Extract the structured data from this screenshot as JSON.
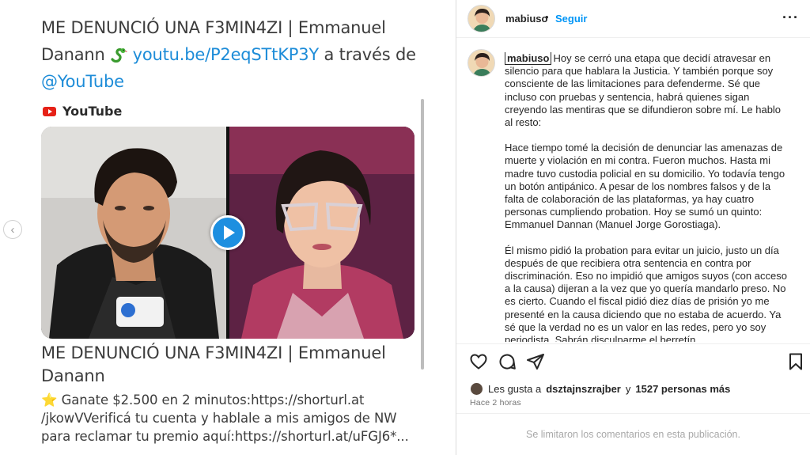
{
  "tweet": {
    "text_before_link": "ME DENUNCIÓ UNA F3MIN4ZI | Emmanuel Danann",
    "link": "youtu.be/P2eqSTtKP3Y",
    "text_after_link": "a través de",
    "mention": "@YouTube",
    "card_source": "YouTube",
    "card_title": "ME DENUNCIÓ UNA F3MIN4ZI | Emmanuel Danann",
    "card_description_star": "⭐",
    "card_description": "Ganate $2.500 en 2 minutos:https://shorturl.at /jkowVVerificá tu cuenta y hablale a mis amigos de NW para reclamar tu premio aquí:https://shorturl.at/uFGJ6*..."
  },
  "post": {
    "username": "mabiuso",
    "follow_label": "Seguir",
    "more_label": "···",
    "caption_user": "mabiuso",
    "caption_paragraphs": [
      "Hoy se cerró una etapa que decidí atravesar en silencio para que hablara la Justicia. Y también porque soy consciente de las limitaciones para defenderme. Sé que incluso con pruebas y sentencia, habrá quienes sigan creyendo las mentiras que se difundieron sobre mí. Le hablo al resto:",
      "Hace tiempo tomé la decisión de denunciar las amenazas de muerte y violación en mi contra. Fueron muchos. Hasta mi madre tuvo custodia policial en su domicilio. Yo todavía tengo un botón antipánico. A pesar de los nombres falsos y de la falta de colaboración de las plataformas, ya hay cuatro personas cumpliendo probation. Hoy se sumó un quinto: Emmanuel Dannan (Manuel Jorge Gorostiaga).",
      "Él mismo pidió la probation para evitar un juicio, justo un día después de que recibiera otra sentencia en contra por discriminación. Eso no impidió que amigos suyos (con acceso a la causa) dijeran a la vez que yo quería mandarlo preso. No es cierto. Cuando el fiscal pidió diez días de prisión yo me presenté en la causa diciendo que no estaba de acuerdo. Ya sé que la verdad no es un valor en las redes, pero yo soy periodista. Sabrán disculparme el berretín."
    ],
    "likes_prefix": "Les gusta a",
    "likes_user": "dsztajnszrajber",
    "likes_conj": "y",
    "likes_count": "1527 personas más",
    "time_ago": "Hace 2 horas",
    "comments_disabled": "Se limitaron los comentarios en esta publicación."
  },
  "colors": {
    "link_blue": "#1d8cd8",
    "follow_blue": "#0095f6",
    "youtube_red": "#e62117"
  },
  "icons": [
    "chevron-left-icon",
    "snake-emoji",
    "youtube-logo-icon",
    "play-icon",
    "more-icon",
    "heart-icon",
    "comment-icon",
    "share-icon",
    "bookmark-icon"
  ]
}
